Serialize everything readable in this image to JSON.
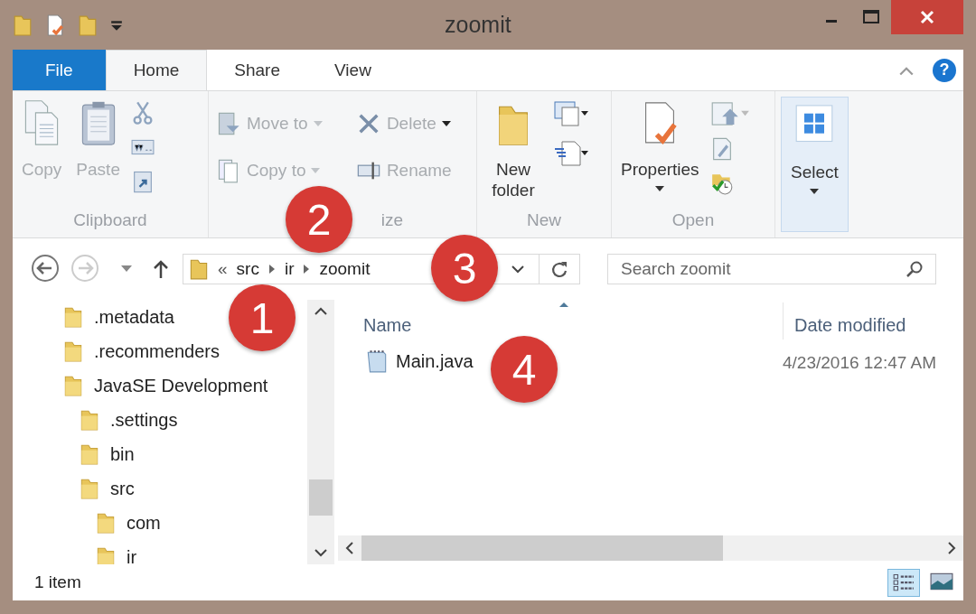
{
  "window": {
    "title": "zoomit"
  },
  "tabs": [
    {
      "label": "File",
      "kind": "file",
      "selected": false
    },
    {
      "label": "Home",
      "kind": "tab",
      "selected": true
    },
    {
      "label": "Share",
      "kind": "tab",
      "selected": false
    },
    {
      "label": "View",
      "kind": "tab",
      "selected": false
    }
  ],
  "ribbon": [
    {
      "label": "Clipboard",
      "commands": [
        {
          "label": "Copy",
          "kind": "large",
          "disabled": true,
          "dropdown": false
        },
        {
          "label": "Paste",
          "kind": "large",
          "disabled": true,
          "dropdown": false
        }
      ]
    },
    {
      "label": "ize",
      "commands": [
        {
          "label": "Move to",
          "kind": "small",
          "disabled": true,
          "dropdown": true
        },
        {
          "label": "Copy to",
          "kind": "small",
          "disabled": true,
          "dropdown": true
        },
        {
          "label": "Delete",
          "kind": "small",
          "disabled": true,
          "dropdown": true
        },
        {
          "label": "Rename",
          "kind": "small",
          "disabled": true,
          "dropdown": false
        }
      ]
    },
    {
      "label": "New",
      "commands": [
        {
          "label": "New folder",
          "kind": "large",
          "disabled": false,
          "dropdown": false
        }
      ]
    },
    {
      "label": "Open",
      "commands": [
        {
          "label": "Properties",
          "kind": "large",
          "disabled": false,
          "dropdown": true
        }
      ]
    },
    {
      "commands": [
        {
          "label": "Select",
          "kind": "large",
          "disabled": false,
          "dropdown": true
        }
      ]
    }
  ],
  "help": "?",
  "address": {
    "overflow": "«",
    "crumbs": [
      "src",
      "ir",
      "zoomit"
    ]
  },
  "search": {
    "placeholder": "Search zoomit"
  },
  "tree": [
    {
      "label": ".metadata"
    },
    {
      "label": ".recommenders"
    },
    {
      "label": "JavaSE Development",
      "children": [
        {
          "label": ".settings"
        },
        {
          "label": "bin"
        },
        {
          "label": "src",
          "children": [
            {
              "label": "com"
            },
            {
              "label": "ir"
            }
          ]
        }
      ]
    }
  ],
  "table": {
    "columns": [
      "Name",
      "Date modified"
    ],
    "rows": [
      {
        "name": "Main.java",
        "date": "4/23/2016 12:47 AM"
      }
    ]
  },
  "status_bar": {
    "text": "1 item",
    "views": [
      {
        "selected": true
      },
      {
        "selected": false
      }
    ]
  },
  "annotations": [
    {
      "number": "1"
    },
    {
      "number": "2"
    },
    {
      "number": "3"
    },
    {
      "number": "4"
    }
  ]
}
